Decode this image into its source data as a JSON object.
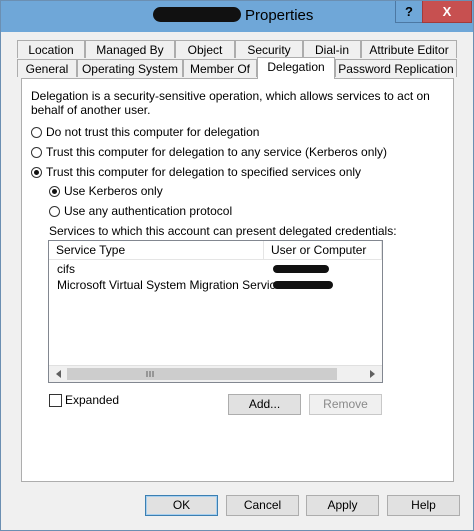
{
  "window": {
    "title": "Properties"
  },
  "tabs_row1": [
    "Location",
    "Managed By",
    "Object",
    "Security",
    "Dial-in",
    "Attribute Editor"
  ],
  "tabs_row2": [
    "General",
    "Operating System",
    "Member Of",
    "Delegation",
    "Password Replication"
  ],
  "active_tab": "Delegation",
  "delegation": {
    "description": "Delegation is a security-sensitive operation, which allows services to act on behalf of another user.",
    "description_line1": "Delegation is a security-sensitive operation, which allows services to act on",
    "description_line2": "behalf of another user.",
    "options": [
      {
        "label": "Do not trust this computer for delegation",
        "selected": false
      },
      {
        "label": "Trust this computer for delegation to any service (Kerberos only)",
        "selected": false
      },
      {
        "label": "Trust this computer for delegation to specified services only",
        "selected": true
      }
    ],
    "sub_options": [
      {
        "label": "Use Kerberos only",
        "selected": true
      },
      {
        "label": "Use any authentication protocol",
        "selected": false
      }
    ],
    "services_label": "Services to which this account can present delegated credentials:",
    "columns": [
      "Service Type",
      "User or Computer"
    ],
    "rows": [
      {
        "service": "cifs"
      },
      {
        "service": "Microsoft Virtual System Migration Service"
      }
    ],
    "expanded_label": "Expanded",
    "expanded_checked": false,
    "add_label": "Add...",
    "remove_label": "Remove"
  },
  "footer": {
    "ok": "OK",
    "cancel": "Cancel",
    "apply": "Apply",
    "help": "Help"
  },
  "titlebar": {
    "help_glyph": "?",
    "close_glyph": "X"
  },
  "colors": {
    "titlebar": "#6fa7d8",
    "close": "#c75050"
  }
}
